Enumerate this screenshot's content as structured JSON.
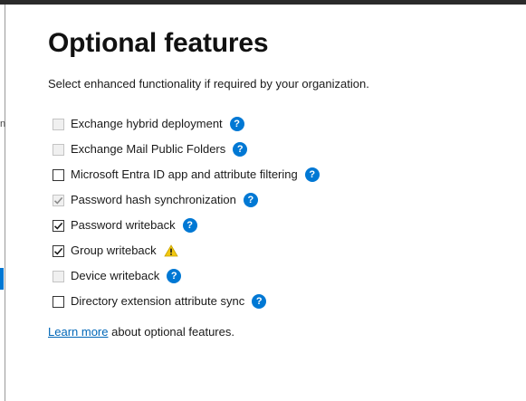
{
  "page": {
    "title": "Optional features",
    "subtitle": "Select enhanced functionality if required by your organization."
  },
  "features": [
    {
      "label": "Exchange hybrid deployment",
      "checked": false,
      "disabled": true,
      "indicator": "help-icon"
    },
    {
      "label": "Exchange Mail Public Folders",
      "checked": false,
      "disabled": true,
      "indicator": "help-icon"
    },
    {
      "label": "Microsoft Entra ID app and attribute filtering",
      "checked": false,
      "disabled": false,
      "indicator": "help-icon"
    },
    {
      "label": "Password hash synchronization",
      "checked": true,
      "disabled": true,
      "indicator": "help-icon"
    },
    {
      "label": "Password writeback",
      "checked": true,
      "disabled": false,
      "indicator": "help-icon"
    },
    {
      "label": "Group writeback",
      "checked": true,
      "disabled": false,
      "indicator": "warning-icon"
    },
    {
      "label": "Device writeback",
      "checked": false,
      "disabled": true,
      "indicator": "help-icon"
    },
    {
      "label": "Directory extension attribute sync",
      "checked": false,
      "disabled": false,
      "indicator": "help-icon"
    }
  ],
  "help_glyph": "?",
  "footer": {
    "link_text": "Learn more",
    "trailing_text": " about optional features."
  },
  "colors": {
    "accent": "#0078d4",
    "link": "#0067b8",
    "warning": "#f2c811"
  }
}
